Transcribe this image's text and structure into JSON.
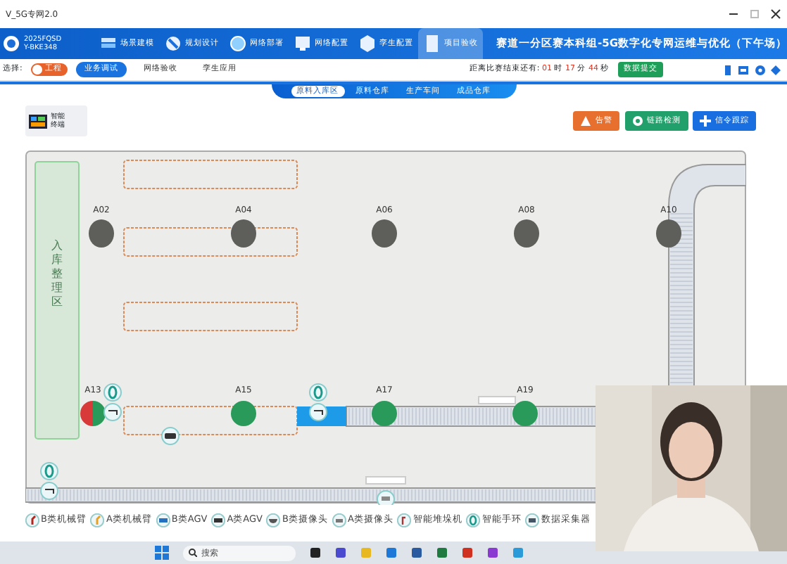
{
  "window": {
    "title": "V_5G专网2.0"
  },
  "header": {
    "logo_lines": [
      "2025FQSD",
      "Y-BKE348"
    ],
    "nav": [
      {
        "label": "场景建模",
        "selected": false
      },
      {
        "label": "规划设计",
        "selected": false
      },
      {
        "label": "网络部署",
        "selected": false
      },
      {
        "label": "网络配置",
        "selected": false
      },
      {
        "label": "孪生配置",
        "selected": false
      },
      {
        "label": "项目验收",
        "selected": true
      }
    ],
    "title": "赛道一分区赛本科组-5G数字化专网运维与优化（下午场）"
  },
  "toolbar": {
    "mode_label": "选择:",
    "toggle": {
      "label": "工程",
      "on": true
    },
    "tabs": [
      {
        "label": "业务调试",
        "selected": true
      },
      {
        "label": "网络验收",
        "selected": false
      },
      {
        "label": "孪生应用",
        "selected": false
      }
    ],
    "countdown": {
      "label": "距离比赛结束还有:",
      "parts": [
        {
          "value": "01",
          "unit": "时"
        },
        {
          "value": "17",
          "unit": "分"
        },
        {
          "value": "44",
          "unit": "秒"
        }
      ]
    },
    "submit_button": "数据提交"
  },
  "sub_tabs": [
    {
      "label": "原料入库区",
      "selected": true
    },
    {
      "label": "原料仓库",
      "selected": false
    },
    {
      "label": "生产车间",
      "selected": false
    },
    {
      "label": "成品仓库",
      "selected": false
    }
  ],
  "terminal": {
    "label": "智能终端"
  },
  "action_buttons": [
    {
      "label": "告警",
      "kind": "warning"
    },
    {
      "label": "链路检测",
      "kind": "success"
    },
    {
      "label": "信令跟踪",
      "kind": "primary"
    }
  ],
  "map": {
    "zone_label": "入库整理区",
    "stations": [
      {
        "label": "A02",
        "kind": "idle"
      },
      {
        "label": "A04",
        "kind": "idle"
      },
      {
        "label": "A06",
        "kind": "idle"
      },
      {
        "label": "A08",
        "kind": "idle"
      },
      {
        "label": "A10",
        "kind": "idle"
      },
      {
        "label": "A13",
        "kind": "alarm"
      },
      {
        "label": "A15",
        "kind": "online"
      },
      {
        "label": "A17",
        "kind": "online"
      },
      {
        "label": "A19",
        "kind": "online"
      }
    ]
  },
  "legend": [
    {
      "label": "B类机械臂"
    },
    {
      "label": "A类机械臂"
    },
    {
      "label": "B类AGV"
    },
    {
      "label": "A类AGV"
    },
    {
      "label": "B类摄像头"
    },
    {
      "label": "A类摄像头"
    },
    {
      "label": "智能堆垛机"
    },
    {
      "label": "智能手环"
    },
    {
      "label": "数据采集器"
    }
  ],
  "taskbar": {
    "search_placeholder": "搜索"
  }
}
